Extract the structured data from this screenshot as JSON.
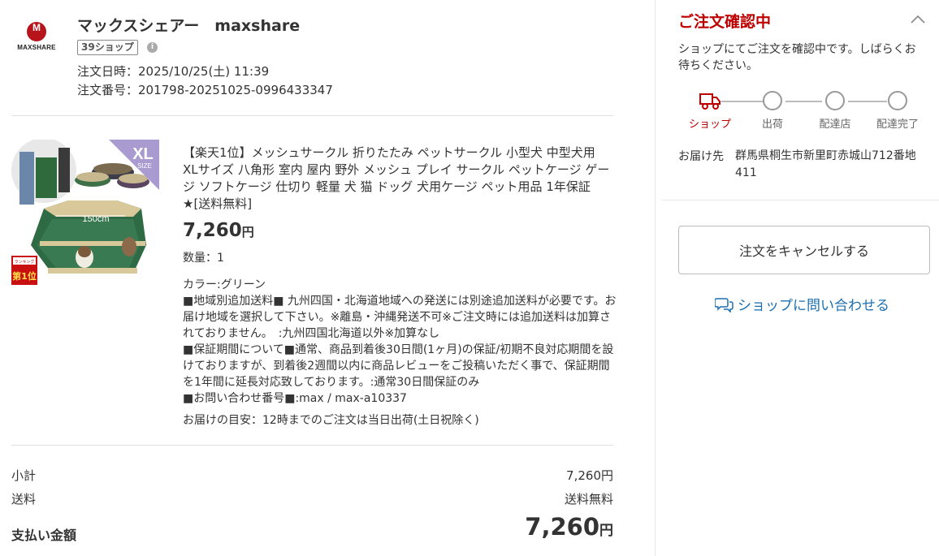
{
  "shop": {
    "logo_text": "MAXSHARE",
    "name": "マックスシェアー　maxshare",
    "badge": "39ショップ",
    "order_date": "注文日時：2025/10/25(土) 11:39",
    "order_number": "注文番号：201798-20251025-0996433347"
  },
  "product": {
    "image_text": {
      "size_badge": "XL",
      "size_sub": "SIZE",
      "dimension": "150cm",
      "ranking": "ランキング",
      "rank": "第1位"
    },
    "title": "【楽天1位】メッシュサークル 折りたたみ ペットサークル 小型犬 中型犬用 XLサイズ 八角形 室内 屋内 野外 メッシュ プレイ サークル ペットケージ ゲージ ソフトケージ 仕切り 軽量 犬 猫 ドッグ 犬用ケージ ペット用品 1年保証 ★[送料無料]",
    "price": "7,260",
    "price_unit": "円",
    "quantity": "数量：1",
    "options": [
      "カラー:グリーン",
      "■地域別追加送料■ 九州四国・北海道地域への発送には別途追加送料が必要です。お届け地域を選択して下さい。※離島・沖縄発送不可※ご注文時には追加送料は加算されておりません。　:九州四国北海道以外※加算なし",
      "■保証期間について■通常、商品到着後30日間(1ヶ月)の保証/初期不良対応期間を設けておりますが、到着後2週間以内に商品レビューをご投稿いただく事で、保証期間を1年間に延長対応致しております。:通常30日間保証のみ",
      "■お問い合わせ番号■:max / max-a10337"
    ],
    "delivery_estimate": "お届けの目安：12時までのご注文は当日出荷(土日祝除く)"
  },
  "summary": {
    "subtotal_label": "小計",
    "subtotal_value": "7,260円",
    "shipping_label": "送料",
    "shipping_value": "送料無料",
    "total_label": "支払い金額",
    "total_value": "7,260",
    "total_unit": "円"
  },
  "status": {
    "title": "ご注文確認中",
    "description": "ショップにてご注文を確認中です。しばらくお待ちください。",
    "steps": [
      {
        "label": "ショップ",
        "active": true
      },
      {
        "label": "出荷",
        "active": false
      },
      {
        "label": "配達店",
        "active": false
      },
      {
        "label": "配達完了",
        "active": false
      }
    ],
    "address_label": "お届け先",
    "address_value": "群馬県桐生市新里町赤城山712番地411",
    "accent_color": "#bf0000"
  },
  "actions": {
    "cancel_label": "注文をキャンセルする",
    "contact_label": "ショップに問い合わせる"
  }
}
